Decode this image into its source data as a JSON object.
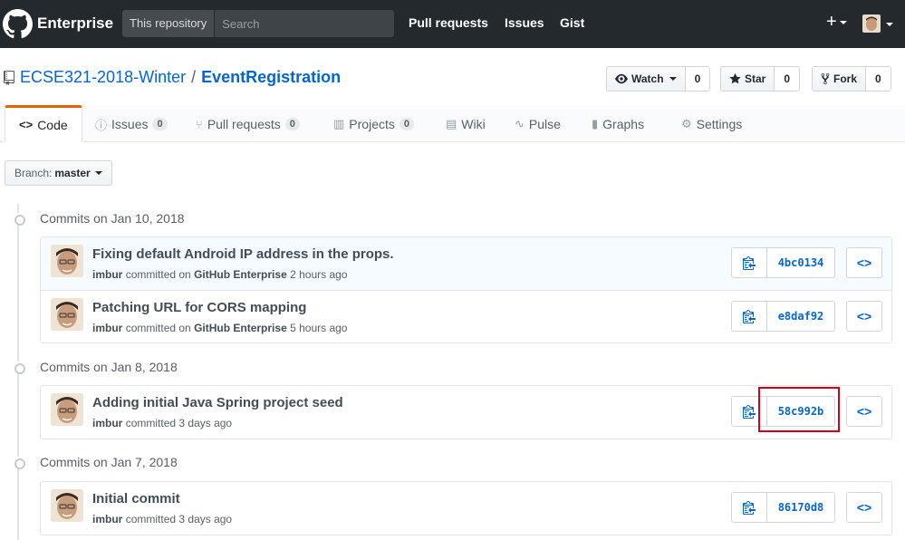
{
  "header": {
    "brand": "Enterprise",
    "scope": "This repository",
    "search_placeholder": "Search",
    "nav": [
      "Pull requests",
      "Issues",
      "Gist"
    ],
    "plus": "+"
  },
  "repo": {
    "owner": "ECSE321-2018-Winter",
    "separator": "/",
    "name": "EventRegistration",
    "watch": {
      "label": "Watch",
      "count": "0"
    },
    "star": {
      "label": "Star",
      "count": "0"
    },
    "fork": {
      "label": "Fork",
      "count": "0"
    }
  },
  "tabs": [
    {
      "label": "Code",
      "icon": "<>",
      "count": null
    },
    {
      "label": "Issues",
      "icon": "ⓘ",
      "count": "0"
    },
    {
      "label": "Pull requests",
      "icon": "⑂",
      "count": "0"
    },
    {
      "label": "Projects",
      "icon": "▥",
      "count": "0"
    },
    {
      "label": "Wiki",
      "icon": "▤",
      "count": null
    },
    {
      "label": "Pulse",
      "icon": "∿",
      "count": null
    },
    {
      "label": "Graphs",
      "icon": "▮",
      "count": null
    },
    {
      "label": "Settings",
      "icon": "⚙",
      "count": null
    }
  ],
  "branch": {
    "prefix": "Branch:",
    "name": "master"
  },
  "groups": [
    {
      "title": "Commits on Jan 10, 2018",
      "commits": [
        {
          "message": "Fixing default Android IP address in the props.",
          "author": "imbur",
          "committed": "committed on",
          "via": "GitHub Enterprise",
          "when": "2 hours ago",
          "sha": "4bc0134"
        },
        {
          "message": "Patching URL for CORS mapping",
          "author": "imbur",
          "committed": "committed on",
          "via": "GitHub Enterprise",
          "when": "5 hours ago",
          "sha": "e8daf92"
        }
      ]
    },
    {
      "title": "Commits on Jan 8, 2018",
      "commits": [
        {
          "message": "Adding initial Java Spring project seed",
          "author": "imbur",
          "committed": "committed",
          "via": "",
          "when": "3 days ago",
          "sha": "58c992b"
        }
      ]
    },
    {
      "title": "Commits on Jan 7, 2018",
      "commits": [
        {
          "message": "Initial commit",
          "author": "imbur",
          "committed": "committed",
          "via": "",
          "when": "3 days ago",
          "sha": "86170d8"
        }
      ]
    }
  ],
  "browse_label": "<>",
  "colors": {
    "header_bg": "#24292e",
    "link": "#0366d6",
    "active_tab": "#e36209",
    "highlight": "#d0021b"
  }
}
